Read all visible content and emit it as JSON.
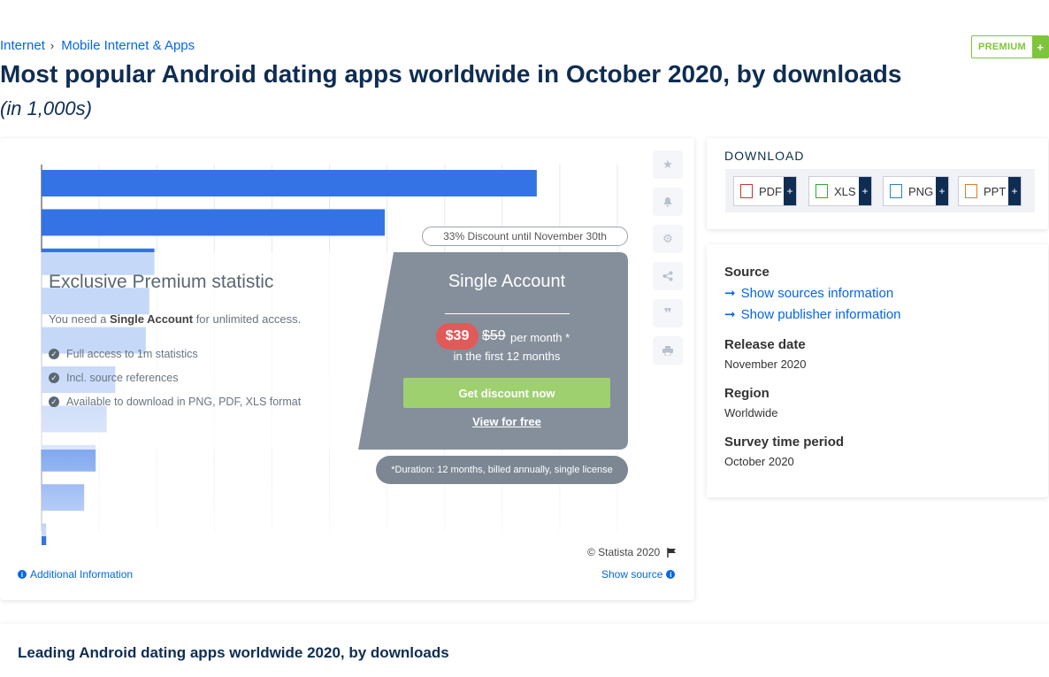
{
  "breadcrumb": {
    "items": [
      "Internet",
      "Mobile Internet & Apps"
    ]
  },
  "premium": {
    "label": "PREMIUM",
    "plus": "+"
  },
  "title": "Most popular Android dating apps worldwide in October 2020, by downloads",
  "subtitle": "(in 1,000s)",
  "chart_data": {
    "type": "bar",
    "orientation": "horizontal",
    "values": [
      860,
      596,
      196,
      187,
      181,
      128,
      113,
      94,
      74,
      8
    ],
    "colors": {
      "bar": "#3373e6"
    }
  },
  "paywall": {
    "discount": "33% Discount until November 30th",
    "heading": "Exclusive Premium statistic",
    "need_prefix": "You need a ",
    "need_bold": "Single Account",
    "need_suffix": " for unlimited access.",
    "features": [
      "Full access to 1m statistics",
      "Incl. source references",
      "Available to download in PNG, PDF, XLS format"
    ],
    "account": "Single Account",
    "price": "$39",
    "old_price": "$59",
    "per_month": "per month *",
    "first_months": "in the first 12 months",
    "cta": "Get discount now",
    "free": "View for free",
    "duration": "*Duration: 12 months, billed annually, single license"
  },
  "toolbar": {
    "icons": [
      "star-icon",
      "bell-icon",
      "gear-icon",
      "share-icon",
      "quote-icon",
      "print-icon"
    ]
  },
  "footer": {
    "copyright": "© Statista 2020",
    "additional": "Additional Information",
    "show_source": "Show source"
  },
  "download": {
    "title": "DOWNLOAD",
    "buttons": [
      "PDF",
      "XLS",
      "PNG",
      "PPT"
    ],
    "plus": "+"
  },
  "info": {
    "source_label": "Source",
    "sources_link": "Show sources information",
    "publisher_link": "Show publisher information",
    "release_label": "Release date",
    "release_value": "November 2020",
    "region_label": "Region",
    "region_value": "Worldwide",
    "survey_label": "Survey time period",
    "survey_value": "October 2020"
  },
  "bottom": {
    "title": "Leading Android dating apps worldwide 2020, by downloads"
  }
}
